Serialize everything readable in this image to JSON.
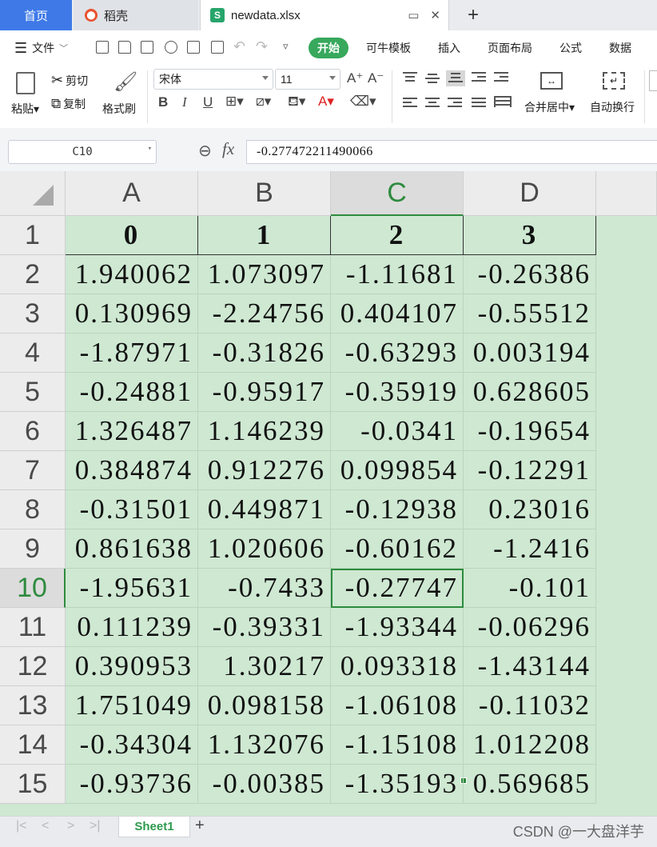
{
  "tabs": {
    "home": "首页",
    "daoke": "稻壳",
    "file": "newdata.xlsx",
    "add": "+"
  },
  "menu": {
    "file": "文件",
    "start": "开始",
    "template": "可牛模板",
    "insert": "插入",
    "layout": "页面布局",
    "formula": "公式",
    "data": "数据"
  },
  "ribbon": {
    "paste": "粘贴",
    "cut": "剪切",
    "copy": "复制",
    "format_painter": "格式刷",
    "font_name": "宋体",
    "font_size": "11",
    "merge_center": "合并居中",
    "wrap_text": "自动换行",
    "bold": "B",
    "italic": "I",
    "underline": "U"
  },
  "formula_bar": {
    "name_box": "C10",
    "fx": "fx",
    "value": "-0.277472211490066"
  },
  "columns": [
    "A",
    "B",
    "C",
    "D"
  ],
  "header_row": [
    "0",
    "1",
    "2",
    "3"
  ],
  "row_numbers": [
    "1",
    "2",
    "3",
    "4",
    "5",
    "6",
    "7",
    "8",
    "9",
    "10",
    "11",
    "12",
    "13",
    "14",
    "15"
  ],
  "rows": [
    [
      "1.940062",
      "1.073097",
      "-1.11681",
      "-0.26386"
    ],
    [
      "0.130969",
      "-2.24756",
      "0.404107",
      "-0.55512"
    ],
    [
      "-1.87971",
      "-0.31826",
      "-0.63293",
      "0.003194"
    ],
    [
      "-0.24881",
      "-0.95917",
      "-0.35919",
      "0.628605"
    ],
    [
      "1.326487",
      "1.146239",
      "-0.0341",
      "-0.19654"
    ],
    [
      "0.384874",
      "0.912276",
      "0.099854",
      "-0.12291"
    ],
    [
      "-0.31501",
      "0.449871",
      "-0.12938",
      "0.23016"
    ],
    [
      "0.861638",
      "1.020606",
      "-0.60162",
      "-1.2416"
    ],
    [
      "-1.95631",
      "-0.7433",
      "-0.27747",
      "-0.101"
    ],
    [
      "0.111239",
      "-0.39331",
      "-1.93344",
      "-0.06296"
    ],
    [
      "0.390953",
      "1.30217",
      "0.093318",
      "-1.43144"
    ],
    [
      "1.751049",
      "0.098158",
      "-1.06108",
      "-0.11032"
    ],
    [
      "-0.34304",
      "1.132076",
      "-1.15108",
      "1.012208"
    ],
    [
      "-0.93736",
      "-0.00385",
      "-1.35193",
      "0.569685"
    ]
  ],
  "sheet": {
    "tab": "Sheet1",
    "add": "+"
  },
  "watermark": "CSDN @一大盘洋芋"
}
